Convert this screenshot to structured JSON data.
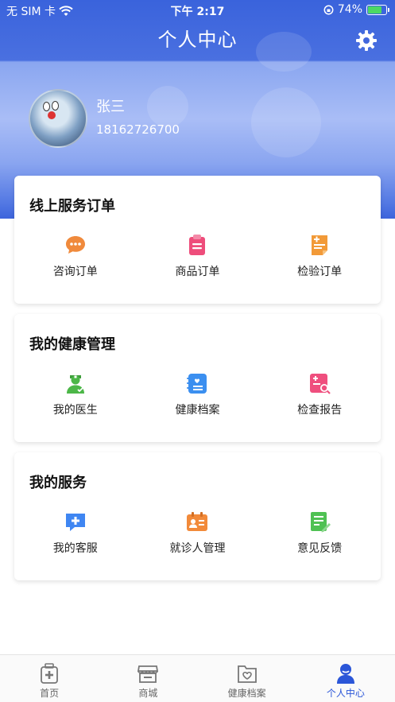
{
  "status_bar": {
    "carrier": "无 SIM 卡",
    "time": "下午 2:17",
    "battery": "74%"
  },
  "header": {
    "title": "个人中心",
    "settings_icon": "gear-icon"
  },
  "profile": {
    "name": "张三",
    "phone": "18162726700"
  },
  "sections": [
    {
      "title": "线上服务订单",
      "items": [
        {
          "label": "咨询订单",
          "icon": "chat-bubble-icon",
          "color": "#f08a3c"
        },
        {
          "label": "商品订单",
          "icon": "clipboard-icon",
          "color": "#ee4d7b"
        },
        {
          "label": "检验订单",
          "icon": "document-plus-icon",
          "color": "#f29a38"
        }
      ]
    },
    {
      "title": "我的健康管理",
      "items": [
        {
          "label": "我的医生",
          "icon": "doctor-icon",
          "color": "#4cb748"
        },
        {
          "label": "健康档案",
          "icon": "health-record-icon",
          "color": "#3b8ff0"
        },
        {
          "label": "检查报告",
          "icon": "report-search-icon",
          "color": "#ef4f7e"
        }
      ]
    },
    {
      "title": "我的服务",
      "items": [
        {
          "label": "我的客服",
          "icon": "service-chat-icon",
          "color": "#3f86f2"
        },
        {
          "label": "就诊人管理",
          "icon": "patient-card-icon",
          "color": "#f28a3a"
        },
        {
          "label": "意见反馈",
          "icon": "feedback-edit-icon",
          "color": "#4fc153"
        }
      ]
    }
  ],
  "tabbar": {
    "tabs": [
      {
        "label": "首页",
        "icon": "home-medical-icon",
        "active": false
      },
      {
        "label": "商城",
        "icon": "store-icon",
        "active": false
      },
      {
        "label": "健康档案",
        "icon": "health-folder-icon",
        "active": false
      },
      {
        "label": "个人中心",
        "icon": "person-icon",
        "active": true
      }
    ],
    "active_color": "#2b56d8"
  }
}
